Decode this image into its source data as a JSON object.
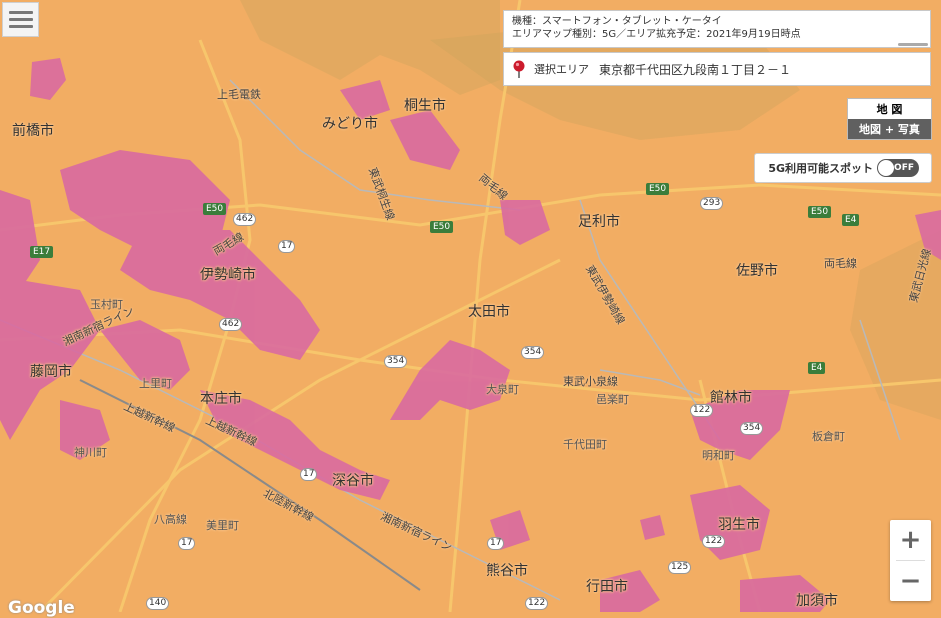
{
  "info": {
    "line1": "機種：スマートフォン・タブレット・ケータイ",
    "line2": "エリアマップ種別：5G／エリア拡充予定：2021年9月19日時点"
  },
  "area": {
    "label": "選択エリア",
    "address": "東京都千代田区九段南１丁目２－１"
  },
  "map_type": {
    "map": "地 図",
    "satellite": "地図 + 写真"
  },
  "spot": {
    "label": "5G利用可能スポット",
    "toggle": "OFF"
  },
  "zoom": {
    "in": "+",
    "out": "−"
  },
  "google": "Google",
  "colors": {
    "coverage": "#d96aa0",
    "base": "#f2ad63",
    "road": "#f7c66c"
  },
  "icons": {
    "menu": "hamburger-icon",
    "pin": "map-pin-icon"
  },
  "cities": [
    "前橋市",
    "みどり市",
    "桐生市",
    "足利市",
    "伊勢崎市",
    "太田市",
    "佐野市",
    "玉村町",
    "藤岡市",
    "本庄市",
    "大泉町",
    "邑楽町",
    "館林市",
    "板倉町",
    "千代田町",
    "明和町",
    "上里町",
    "神川町",
    "深谷市",
    "八高線",
    "美里町",
    "羽生市",
    "熊谷市",
    "行田市",
    "加須市"
  ],
  "rails": [
    "上毛電鉄",
    "東武桐生線",
    "両毛線",
    "両毛線",
    "両毛線",
    "湘南新宿ライン",
    "上越新幹線",
    "東武伊勢崎線",
    "東武小泉線",
    "北陸新幹線",
    "湘南新宿ライン",
    "東武日光線",
    "上越新幹線"
  ],
  "highways": [
    "E50",
    "E50",
    "E50",
    "E50",
    "E17",
    "E4",
    "E4"
  ],
  "routes": [
    "462",
    "17",
    "462",
    "293",
    "354",
    "354",
    "122",
    "354",
    "17",
    "17",
    "140",
    "122",
    "122",
    "125",
    "17"
  ]
}
